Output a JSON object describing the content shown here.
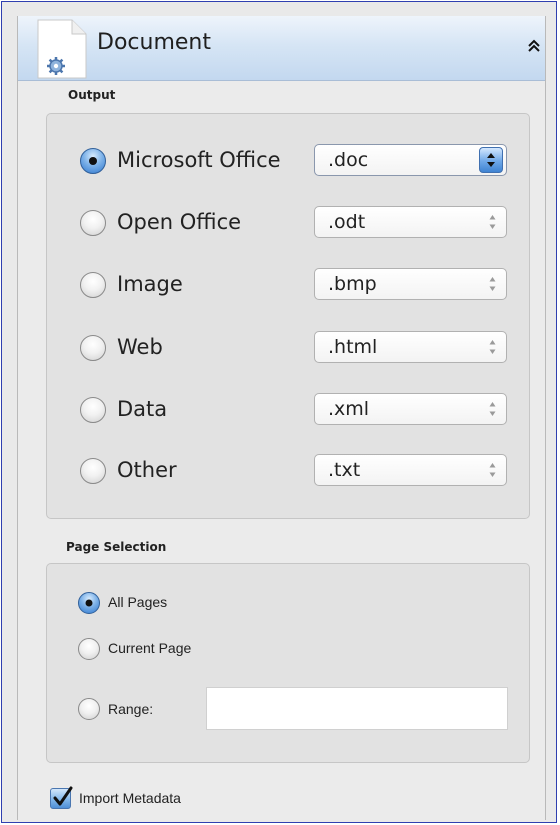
{
  "panel": {
    "title": "Document",
    "collapse_icon": "chevron-double-up-icon",
    "doc_icon": "document-gear-icon"
  },
  "output": {
    "section_label": "Output",
    "options": [
      {
        "label": "Microsoft Office",
        "format": ".doc",
        "selected": true
      },
      {
        "label": "Open Office",
        "format": ".odt",
        "selected": false
      },
      {
        "label": "Image",
        "format": ".bmp",
        "selected": false
      },
      {
        "label": "Web",
        "format": ".html",
        "selected": false
      },
      {
        "label": "Data",
        "format": ".xml",
        "selected": false
      },
      {
        "label": "Other",
        "format": ".txt",
        "selected": false
      }
    ]
  },
  "page_selection": {
    "section_label": "Page Selection",
    "all_pages": "All Pages",
    "current_page": "Current Page",
    "range": "Range:",
    "range_value": "",
    "selected": "all_pages"
  },
  "import_metadata": {
    "label": "Import Metadata",
    "checked": true
  },
  "colors": {
    "accent": "#2f78cf",
    "frame_border": "#2f3fb0",
    "header_gradient_top": "#eef4fb",
    "header_gradient_bottom": "#c3d8ef"
  }
}
